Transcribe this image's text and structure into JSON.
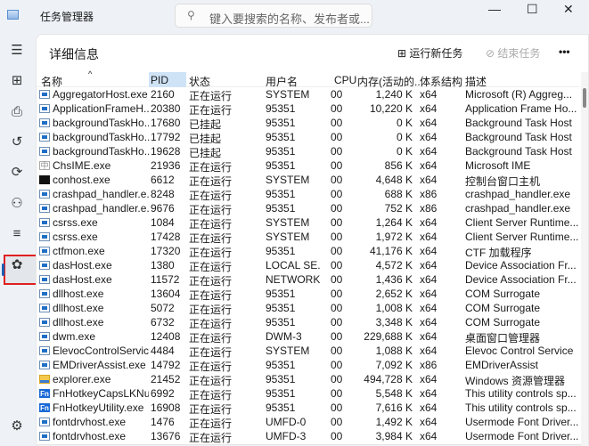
{
  "app": {
    "title": "任务管理器",
    "search_placeholder": "键入要搜索的名称、发布者或..."
  },
  "window": {
    "minimize": "—",
    "maximize": "☐",
    "close": "✕"
  },
  "sidebar": [
    "menu-icon",
    "processes-icon",
    "performance-icon",
    "app-history-icon",
    "startup-icon",
    "users-icon",
    "details-icon",
    "services-icon",
    "settings-icon"
  ],
  "page": {
    "title": "详细信息",
    "run_new_task": "运行新任务",
    "end_task": "结束任务",
    "more": "•••"
  },
  "columns": {
    "name": "名称",
    "pid": "PID",
    "status": "状态",
    "user": "用户名",
    "cpu": "CPU",
    "memory": "内存(活动的...",
    "arch": "体系结构",
    "desc": "描述"
  },
  "rows": [
    [
      "AggregatorHost.exe",
      "2160",
      "正在运行",
      "SYSTEM",
      "00",
      "1,240 K",
      "x64",
      "Microsoft (R) Aggreg...",
      "app"
    ],
    [
      "ApplicationFrameH...",
      "20380",
      "正在运行",
      "95351",
      "00",
      "10,220 K",
      "x64",
      "Application Frame Ho...",
      "app"
    ],
    [
      "backgroundTaskHo...",
      "17680",
      "已挂起",
      "95351",
      "00",
      "0 K",
      "x64",
      "Background Task Host",
      "app"
    ],
    [
      "backgroundTaskHo...",
      "17792",
      "已挂起",
      "95351",
      "00",
      "0 K",
      "x64",
      "Background Task Host",
      "app"
    ],
    [
      "backgroundTaskHo...",
      "19628",
      "已挂起",
      "95351",
      "00",
      "0 K",
      "x64",
      "Background Task Host",
      "app"
    ],
    [
      "ChsIME.exe",
      "21936",
      "正在运行",
      "95351",
      "00",
      "856 K",
      "x64",
      "Microsoft IME",
      "ime"
    ],
    [
      "conhost.exe",
      "6612",
      "正在运行",
      "SYSTEM",
      "00",
      "4,648 K",
      "x64",
      "控制台窗口主机",
      "term"
    ],
    [
      "crashpad_handler.e...",
      "8248",
      "正在运行",
      "95351",
      "00",
      "688 K",
      "x86",
      "crashpad_handler.exe",
      "app"
    ],
    [
      "crashpad_handler.e...",
      "9676",
      "正在运行",
      "95351",
      "00",
      "752 K",
      "x86",
      "crashpad_handler.exe",
      "app"
    ],
    [
      "csrss.exe",
      "1084",
      "正在运行",
      "SYSTEM",
      "00",
      "1,264 K",
      "x64",
      "Client Server Runtime...",
      "app"
    ],
    [
      "csrss.exe",
      "17428",
      "正在运行",
      "SYSTEM",
      "00",
      "1,972 K",
      "x64",
      "Client Server Runtime...",
      "app"
    ],
    [
      "ctfmon.exe",
      "17320",
      "正在运行",
      "95351",
      "00",
      "41,176 K",
      "x64",
      "CTF 加载程序",
      "app"
    ],
    [
      "dasHost.exe",
      "1380",
      "正在运行",
      "LOCAL SE...",
      "00",
      "4,572 K",
      "x64",
      "Device Association Fr...",
      "app"
    ],
    [
      "dasHost.exe",
      "11572",
      "正在运行",
      "NETWORK...",
      "00",
      "1,436 K",
      "x64",
      "Device Association Fr...",
      "app"
    ],
    [
      "dllhost.exe",
      "13604",
      "正在运行",
      "95351",
      "00",
      "2,652 K",
      "x64",
      "COM Surrogate",
      "app"
    ],
    [
      "dllhost.exe",
      "5072",
      "正在运行",
      "95351",
      "00",
      "1,008 K",
      "x64",
      "COM Surrogate",
      "app"
    ],
    [
      "dllhost.exe",
      "6732",
      "正在运行",
      "95351",
      "00",
      "3,348 K",
      "x64",
      "COM Surrogate",
      "app"
    ],
    [
      "dwm.exe",
      "12408",
      "正在运行",
      "DWM-3",
      "00",
      "229,688 K",
      "x64",
      "桌面窗口管理器",
      "app"
    ],
    [
      "ElevocControlServic...",
      "4484",
      "正在运行",
      "SYSTEM",
      "00",
      "1,088 K",
      "x64",
      "Elevoc Control Service",
      "app"
    ],
    [
      "EMDriverAssist.exe",
      "14792",
      "正在运行",
      "95351",
      "00",
      "7,092 K",
      "x86",
      "EMDriverAssist",
      "app"
    ],
    [
      "explorer.exe",
      "21452",
      "正在运行",
      "95351",
      "00",
      "494,728 K",
      "x64",
      "Windows 资源管理器",
      "fold"
    ],
    [
      "FnHotkeyCapsLKNu...",
      "6992",
      "正在运行",
      "95351",
      "00",
      "5,548 K",
      "x64",
      "This utility controls sp...",
      "fn"
    ],
    [
      "FnHotkeyUtility.exe",
      "16908",
      "正在运行",
      "95351",
      "00",
      "7,616 K",
      "x64",
      "This utility controls sp...",
      "fn"
    ],
    [
      "fontdrvhost.exe",
      "1476",
      "正在运行",
      "UMFD-0",
      "00",
      "1,492 K",
      "x64",
      "Usermode Font Driver...",
      "app"
    ],
    [
      "fontdrvhost.exe",
      "13676",
      "正在运行",
      "UMFD-3",
      "00",
      "3,984 K",
      "x64",
      "Usermode Font Driver...",
      "app"
    ]
  ]
}
